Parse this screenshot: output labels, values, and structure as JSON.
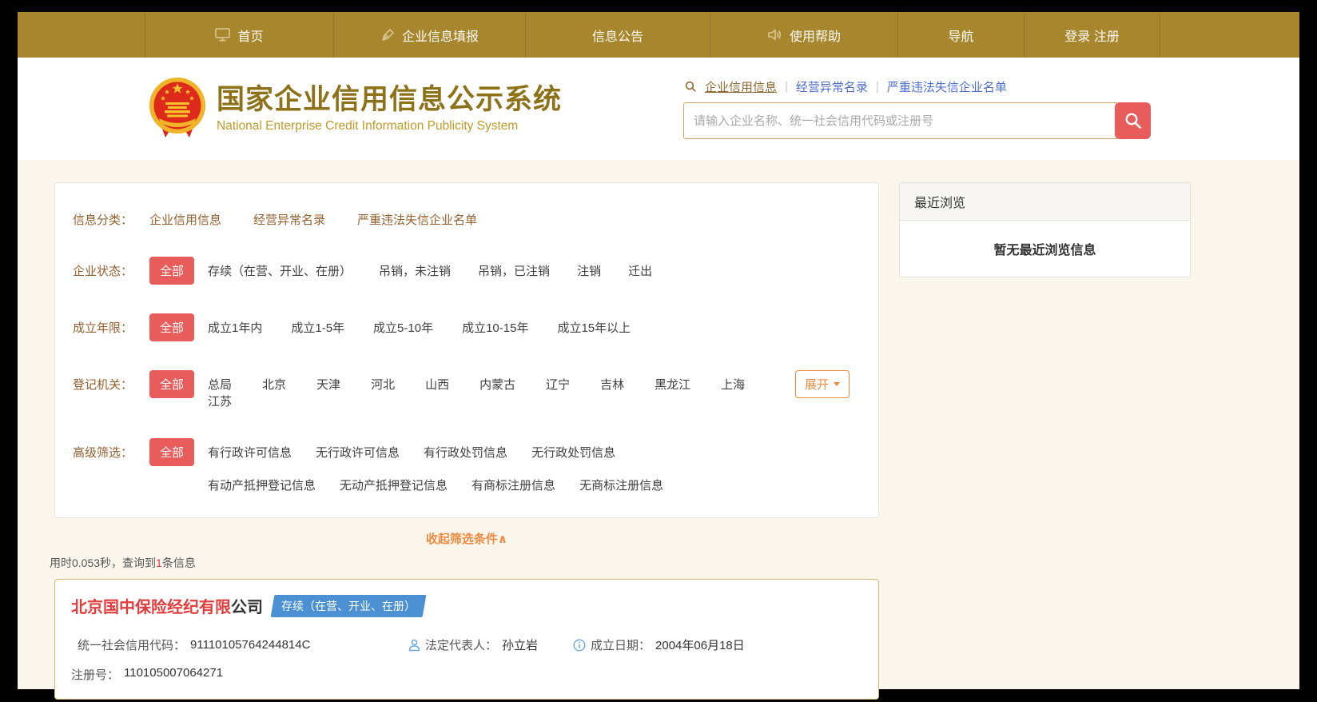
{
  "nav": {
    "items": [
      {
        "label": "首页"
      },
      {
        "label": "企业信息填报"
      },
      {
        "label": "信息公告"
      },
      {
        "label": "使用帮助"
      },
      {
        "label": "导航"
      },
      {
        "label": "登录 注册"
      }
    ]
  },
  "header": {
    "title": "国家企业信用信息公示系统",
    "subtitle": "National Enterprise Credit Information Publicity System",
    "search_links": [
      {
        "label": "企业信用信息",
        "active": true
      },
      {
        "label": "经营异常名录"
      },
      {
        "label": "严重违法失信企业名单"
      }
    ],
    "search_placeholder": "请输入企业名称、统一社会信用代码或注册号"
  },
  "filters": {
    "all_label": "全部",
    "rows": [
      {
        "label": "信息分类：",
        "options": [
          "企业信用信息",
          "经营异常名录",
          "严重违法失信企业名单"
        ]
      },
      {
        "label": "企业状态：",
        "options": [
          "存续（在营、开业、在册）",
          "吊销，未注销",
          "吊销，已注销",
          "注销",
          "迁出"
        ]
      },
      {
        "label": "成立年限：",
        "options": [
          "成立1年内",
          "成立1-5年",
          "成立5-10年",
          "成立10-15年",
          "成立15年以上"
        ]
      },
      {
        "label": "登记机关：",
        "options": [
          "总局",
          "北京",
          "天津",
          "河北",
          "山西",
          "内蒙古",
          "辽宁",
          "吉林",
          "黑龙江",
          "上海",
          "江苏"
        ]
      },
      {
        "label": "高级筛选：",
        "options": [
          "有行政许可信息",
          "无行政许可信息",
          "有行政处罚信息",
          "无行政处罚信息"
        ],
        "options2": [
          "有动产抵押登记信息",
          "无动产抵押登记信息",
          "有商标注册信息",
          "无商标注册信息"
        ]
      }
    ],
    "expand_label": "展开",
    "collapse_label": "收起筛选条件∧"
  },
  "results": {
    "summary_prefix": "用时0.053秒，查询到",
    "summary_count": "1",
    "summary_suffix": "条信息",
    "card": {
      "name_highlight": "北京国中保险经纪有限",
      "name_rest": "公司",
      "status_badge": "存续（在营、开业、在册）",
      "credit_code_label": "统一社会信用代码：",
      "credit_code": "91110105764244814C",
      "legal_rep_label": "法定代表人：",
      "legal_rep": "孙立岩",
      "establish_label": "成立日期：",
      "establish_date": "2004年06月18日",
      "reg_no_label": "注册号：",
      "reg_no": "110105007064271"
    }
  },
  "sidebar": {
    "title": "最近浏览",
    "empty_text": "暂无最近浏览信息"
  },
  "colors": {
    "nav_gold": "#a8862d",
    "page_cream": "#faf6ec",
    "accent_red": "#e85c5c",
    "accent_orange": "#f08a3c",
    "link_blue": "#4d6fd0",
    "badge_blue": "#4a90d2",
    "highlight_red": "#e23c3c",
    "title_gold": "#8e7219"
  }
}
